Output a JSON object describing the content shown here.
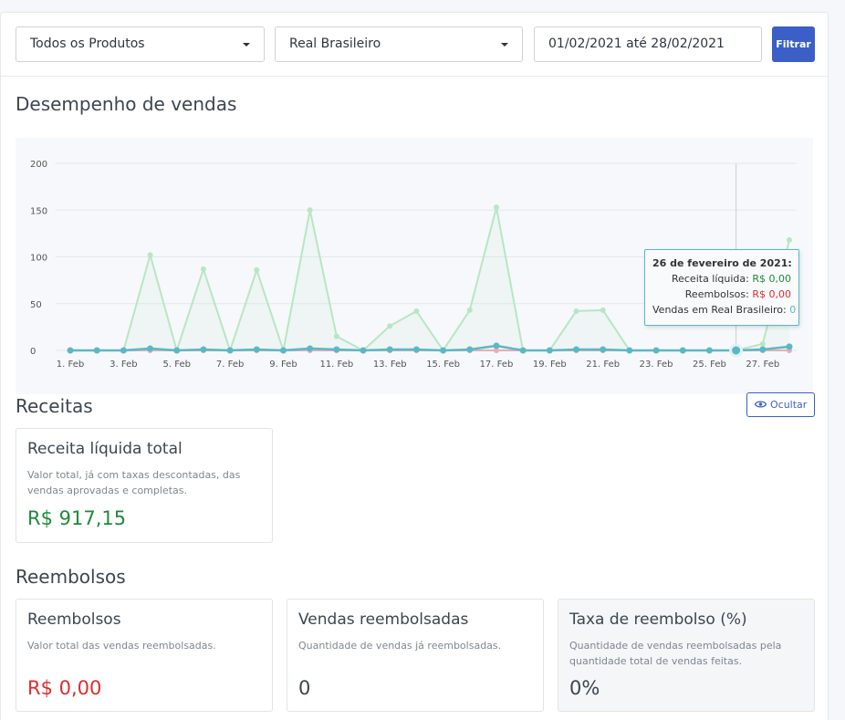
{
  "filters": {
    "product": "Todos os Produtos",
    "currency": "Real Brasileiro",
    "date_range": "01/02/2021 até 28/02/2021",
    "filter_button": "Filtrar"
  },
  "sales_section": {
    "title": "Desempenho de vendas"
  },
  "chart_data": {
    "type": "line",
    "x": [
      "1. Feb",
      "2. Feb",
      "3. Feb",
      "4. Feb",
      "5. Feb",
      "6. Feb",
      "7. Feb",
      "8. Feb",
      "9. Feb",
      "10. Feb",
      "11. Feb",
      "12. Feb",
      "13. Feb",
      "14. Feb",
      "15. Feb",
      "16. Feb",
      "17. Feb",
      "18. Feb",
      "19. Feb",
      "20. Feb",
      "21. Feb",
      "22. Feb",
      "23. Feb",
      "24. Feb",
      "25. Feb",
      "26. Feb",
      "27. Feb",
      "28. Feb"
    ],
    "tick_labels": [
      "1. Feb",
      "3. Feb",
      "5. Feb",
      "7. Feb",
      "9. Feb",
      "11. Feb",
      "13. Feb",
      "15. Feb",
      "17. Feb",
      "19. Feb",
      "21. Feb",
      "23. Feb",
      "25. Feb",
      "27. Feb"
    ],
    "y_ticks": [
      0,
      50,
      100,
      150,
      200
    ],
    "ylim": [
      0,
      200
    ],
    "series": [
      {
        "name": "Receita líquida",
        "color": "#b8e6c4",
        "values": [
          0,
          0,
          0,
          102,
          0,
          87,
          0,
          86,
          0,
          150,
          15,
          0,
          26,
          42,
          0,
          43,
          153,
          0,
          0,
          42,
          43,
          0,
          0,
          0,
          0,
          0,
          7,
          118
        ]
      },
      {
        "name": "Reembolsos",
        "color": "#f2a9b0",
        "values": [
          0,
          0,
          0,
          0,
          0,
          0,
          0,
          0,
          0,
          0,
          0,
          0,
          0,
          0,
          0,
          0,
          0,
          0,
          0,
          0,
          0,
          0,
          0,
          0,
          0,
          0,
          0,
          0
        ]
      },
      {
        "name": "Vendas em Real Brasileiro",
        "color": "#5ab8c6",
        "values": [
          0,
          0,
          0,
          2,
          0,
          1,
          0,
          1,
          0,
          2,
          1,
          0,
          1,
          1,
          0,
          1,
          5,
          0,
          0,
          1,
          1,
          0,
          0,
          0,
          0,
          0,
          1,
          4
        ]
      }
    ],
    "grid": true,
    "highlight_index": 25
  },
  "tooltip": {
    "title": "26 de fevereiro de 2021:",
    "net_revenue_label": "Receita líquida:",
    "net_revenue_value": "R$ 0,00",
    "refunds_label": "Reembolsos:",
    "refunds_value": "R$ 0,00",
    "sales_label": "Vendas em Real Brasileiro:",
    "sales_value": "0"
  },
  "revenue_section": {
    "title": "Receitas",
    "hide_button": "Ocultar",
    "card": {
      "title": "Receita líquida total",
      "description": "Valor total, já com taxas descontadas, das vendas aprovadas e completas.",
      "value": "R$ 917,15"
    }
  },
  "refunds_section": {
    "title": "Reembolsos",
    "cards": [
      {
        "title": "Reembolsos",
        "description": "Valor total das vendas reembolsadas.",
        "value": "R$ 0,00"
      },
      {
        "title": "Vendas reembolsadas",
        "description": "Quantidade de vendas já reembolsadas.",
        "value": "0"
      },
      {
        "title": "Taxa de reembolso (%)",
        "description": "Quantidade de vendas reembolsadas pela quantidade total de vendas feitas.",
        "value": "0%"
      }
    ]
  },
  "colors": {
    "accent": "#3b5fc7",
    "positive": "#1f8a3c",
    "negative": "#d8302f",
    "series_teal": "#5ab8c6"
  }
}
